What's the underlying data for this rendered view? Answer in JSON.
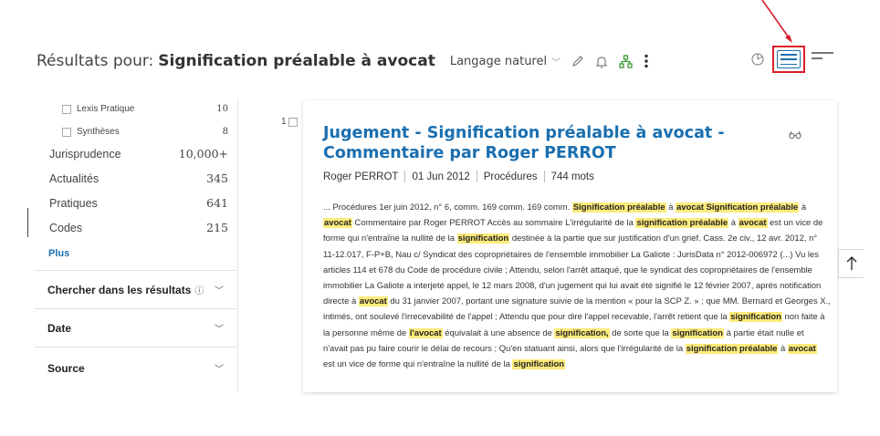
{
  "header": {
    "prefix": "Résultats pour:",
    "query": "Signification préalable à avocat",
    "language_mode": "Langage naturel"
  },
  "sidebar": {
    "facets_small": [
      {
        "label": "Lexis Pratique",
        "count": "10"
      },
      {
        "label": "Synthèses",
        "count": "8"
      }
    ],
    "facets": [
      {
        "label": "Jurisprudence",
        "count": "10,000+"
      },
      {
        "label": "Actualités",
        "count": "345"
      },
      {
        "label": "Pratiques",
        "count": "641"
      },
      {
        "label": "Codes",
        "count": "215"
      }
    ],
    "more_label": "Plus",
    "sections": [
      {
        "label": "Chercher dans les résultats",
        "info": "ⓘ"
      },
      {
        "label": "Date"
      },
      {
        "label": "Source"
      }
    ]
  },
  "result": {
    "number": "1",
    "title": "Jugement - Signification préalable à avocat - Commentaire par Roger PERROT",
    "author": "Roger PERROT",
    "date": "01 Jun 2012",
    "source": "Procédures",
    "words": "744 mots",
    "snippet": [
      {
        "t": "... Procédures 1er juin 2012, n° 6, comm. 169 comm. 169 comm. "
      },
      {
        "t": "Signification préalable",
        "h": true
      },
      {
        "t": " à "
      },
      {
        "t": "avocat Signification préalable",
        "h": true
      },
      {
        "t": " à "
      },
      {
        "t": "avocat",
        "h": true
      },
      {
        "t": " Commentaire par Roger PERROT Accès au sommaire L'irrégularité de la "
      },
      {
        "t": "signification préalable",
        "h": true
      },
      {
        "t": " à "
      },
      {
        "t": "avocat",
        "h": true
      },
      {
        "t": " est un vice de forme qui n'entraîne la nullité de la "
      },
      {
        "t": "signification",
        "h": true
      },
      {
        "t": " destinée à la partie que sur justification d'un grief. Cass. 2e civ., 12 avr. 2012, n° 11-12.017, F-P+B, Nau c/ Syndicat des copropriétaires de l'ensemble immobilier La Galiote : JurisData n° 2012-006972 (...) Vu les articles 114 et 678 du Code de procédure civile ; Attendu, selon l'arrêt attaqué, que le syndicat des copropriétaires de l'ensemble immobilier La Galiote a interjeté appel, le 12 mars 2008, d'un jugement qui lui avait été signifié le 12 février 2007, après notification directe à "
      },
      {
        "t": "avocat",
        "h": true
      },
      {
        "t": " du 31 janvier 2007, portant une signature suivie de la mention « pour la SCP Z. » ; que MM. Bernard et Georges X., intimés, ont soulevé l'irrecevabilité de l'appel ; Attendu que pour dire l'appel recevable, l'arrêt retient que la "
      },
      {
        "t": "signification",
        "h": true
      },
      {
        "t": " non faite à la personne même de "
      },
      {
        "t": "l'avocat",
        "h": true
      },
      {
        "t": " équivalait à une absence de "
      },
      {
        "t": "signification,",
        "h": true
      },
      {
        "t": " de sorte que la "
      },
      {
        "t": "signification",
        "h": true
      },
      {
        "t": " à partie était nulle et n'avait pas pu faire courir le délai de recours ; Qu'en statuant ainsi, alors que l'irrégularité de la "
      },
      {
        "t": "signification préalable",
        "h": true
      },
      {
        "t": " à "
      },
      {
        "t": "avocat",
        "h": true
      },
      {
        "t": " est un vice de forme qui n'entraîne la nullité de la "
      },
      {
        "t": "signification",
        "h": true
      }
    ]
  },
  "colors": {
    "link_blue": "#1a6fb0",
    "highlight": "#fdeb7b",
    "annotation_red": "#d91e2a",
    "hierarchy_green": "#3d9b35"
  },
  "icons": [
    "pencil-icon",
    "bell-icon",
    "hierarchy-icon",
    "more-vertical-icon",
    "pie-chart-icon",
    "list-view-icon",
    "compact-view-icon",
    "glasses-icon",
    "arrow-up-icon"
  ]
}
